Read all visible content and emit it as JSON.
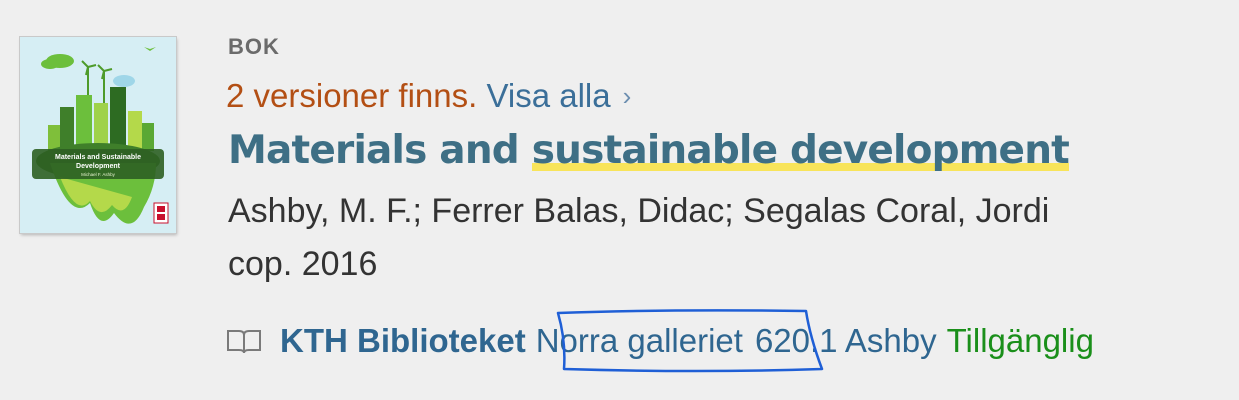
{
  "record": {
    "type_label": "BOK",
    "versions_text": "2 versioner finns.",
    "show_all_label": "Visa alla",
    "chevron_glyph": "›",
    "title_part1": "Materials and ",
    "title_highlight": "sustainable development",
    "authors": "Ashby, M. F.; Ferrer Balas, Didac; Segalas Coral, Jordi",
    "date": "cop. 2016"
  },
  "cover": {
    "title_line1": "Materials and Sustainable",
    "title_line2": "Development",
    "author": "Michael F. Ashby"
  },
  "holding": {
    "icon": "book-open-icon",
    "library": "KTH Biblioteket",
    "location": "Norra galleriet",
    "call_number": "620.1 Ashby",
    "status": "Tillgänglig"
  },
  "colors": {
    "versions": "#b34f14",
    "link": "#3b6f99",
    "title": "#3e6f85",
    "highlight": "#f8e45a",
    "available": "#1a8f1a",
    "annotation": "#1f5fd6"
  }
}
